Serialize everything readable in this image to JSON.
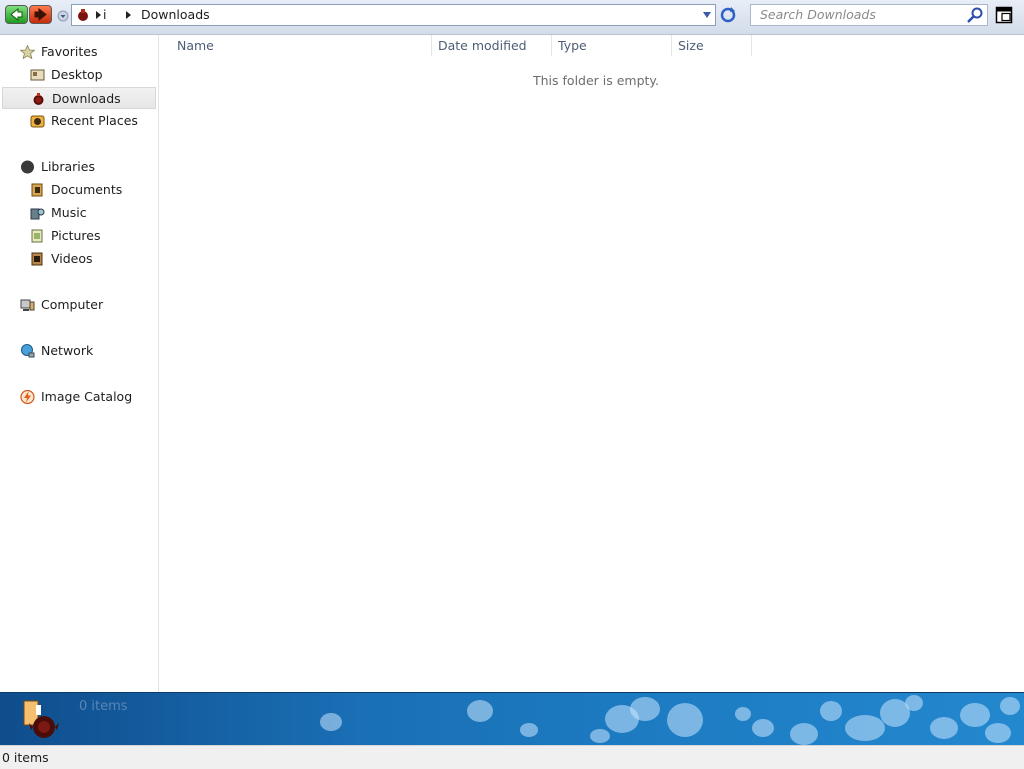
{
  "toolbar": {
    "breadcrumb": [
      "i",
      "Downloads"
    ],
    "search_placeholder": "Search Downloads"
  },
  "sidebar": {
    "favorites": {
      "label": "Favorites",
      "items": [
        {
          "label": "Desktop",
          "icon": "desktop-icon"
        },
        {
          "label": "Downloads",
          "icon": "downloads-icon",
          "selected": true
        },
        {
          "label": "Recent Places",
          "icon": "recent-places-icon"
        }
      ]
    },
    "libraries": {
      "label": "Libraries",
      "items": [
        {
          "label": "Documents",
          "icon": "documents-icon"
        },
        {
          "label": "Music",
          "icon": "music-icon"
        },
        {
          "label": "Pictures",
          "icon": "pictures-icon"
        },
        {
          "label": "Videos",
          "icon": "videos-icon"
        }
      ]
    },
    "computer": {
      "label": "Computer"
    },
    "network": {
      "label": "Network"
    },
    "image_catalog": {
      "label": "Image Catalog"
    }
  },
  "content": {
    "columns": [
      "Name",
      "Date modified",
      "Type",
      "Size"
    ],
    "empty_message": "This folder is empty."
  },
  "details": {
    "count": "0 items"
  },
  "statusbar": {
    "text": "0 items"
  },
  "colors": {
    "back_button": "#2fb12f",
    "forward_button": "#d8451c",
    "details_pane": "#1a6fb5",
    "selected_item": "#e8e8e8"
  }
}
